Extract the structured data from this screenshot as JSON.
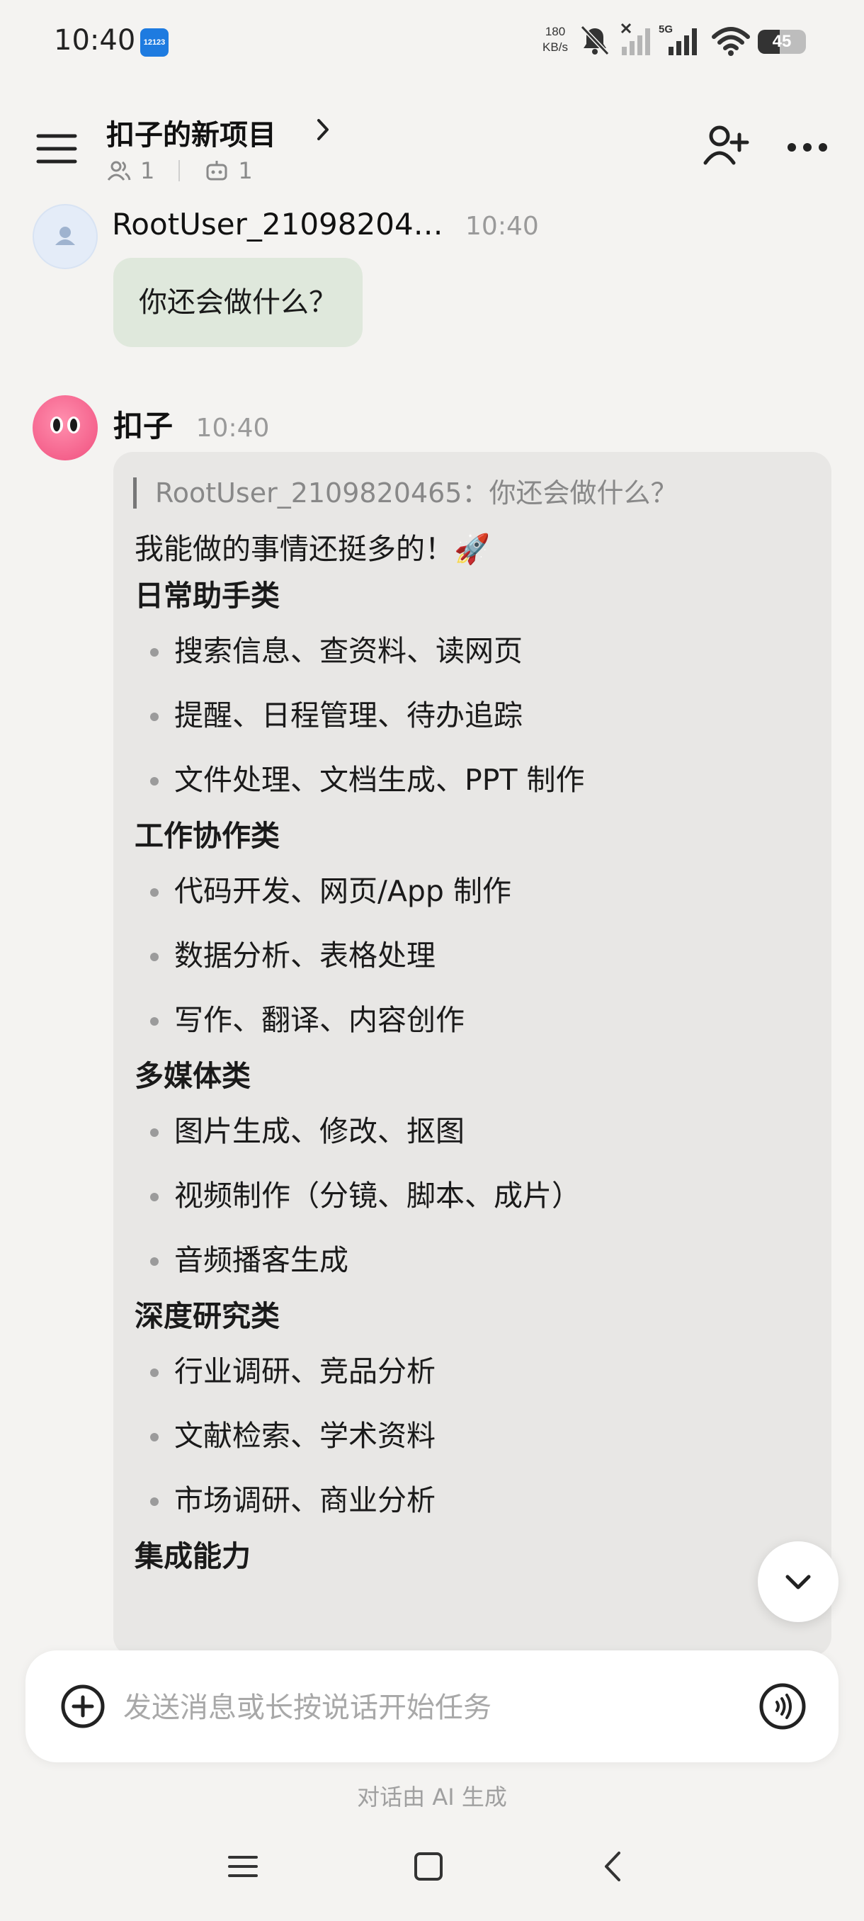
{
  "status_bar": {
    "time": "10:40",
    "app_badge": "12123",
    "speed_value": "180",
    "speed_unit": "KB/s",
    "network": "5G",
    "battery": "45",
    "battery_level_percent": 45
  },
  "header": {
    "title": "扣子的新项目",
    "member_count": "1",
    "bot_count": "1"
  },
  "messages": {
    "user": {
      "name": "RootUser_21098204…",
      "time": "10:40",
      "text": "你还会做什么？"
    },
    "bot": {
      "name": "扣子",
      "time": "10:40",
      "quote": "RootUser_2109820465：你还会做什么？",
      "intro": "我能做的事情还挺多的！🚀",
      "categories": [
        {
          "title": "日常助手类",
          "items": [
            "搜索信息、查资料、读网页",
            "提醒、日程管理、待办追踪",
            "文件处理、文档生成、PPT 制作"
          ]
        },
        {
          "title": "工作协作类",
          "items": [
            "代码开发、网页/App 制作",
            "数据分析、表格处理",
            "写作、翻译、内容创作"
          ]
        },
        {
          "title": "多媒体类",
          "items": [
            "图片生成、修改、抠图",
            "视频制作（分镜、脚本、成片）",
            "音频播客生成"
          ]
        },
        {
          "title": "深度研究类",
          "items": [
            "行业调研、竞品分析",
            "文献检索、学术资料",
            "市场调研、商业分析"
          ]
        },
        {
          "title": "集成能力",
          "items": []
        }
      ]
    }
  },
  "input": {
    "placeholder": "发送消息或长按说话开始任务"
  },
  "footer_note": "对话由 AI 生成",
  "colors": {
    "background": "#f4f3f1",
    "user_bubble": "#dfe8dc",
    "bot_bubble": "#e8e7e5",
    "bot_avatar": "#f04f7e"
  }
}
